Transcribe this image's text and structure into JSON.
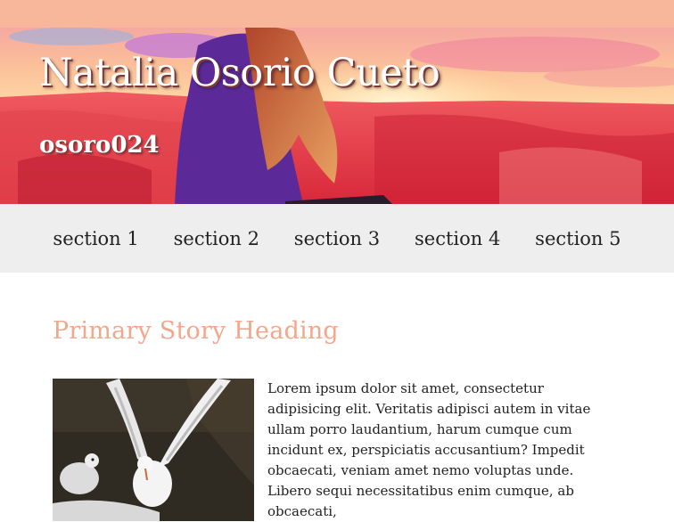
{
  "header": {
    "title": "Natalia Osorio Cueto",
    "subtitle": "osoro024",
    "background_icon": "desert-canyon-photo"
  },
  "nav": {
    "items": [
      {
        "label": "section 1"
      },
      {
        "label": "section 2"
      },
      {
        "label": "section 3"
      },
      {
        "label": "section 4"
      },
      {
        "label": "section 5"
      }
    ]
  },
  "main": {
    "heading": "Primary Story Heading",
    "image_icon": "seagulls-photo",
    "paragraphs": [
      "Lorem ipsum dolor sit amet, consectetur adipisicing elit. Veritatis adipisci autem in vitae ullam porro laudantium, harum cumque cum incidunt ex, perspiciatis accusantium? Impedit obcaecati, veniam amet nemo voluptas unde.",
      "Libero sequi necessitatibus enim cumque, ab obcaecati,"
    ]
  },
  "colors": {
    "topbar": "#f8b69a",
    "heading": "#f2a78a",
    "nav_bg": "#eeeeee",
    "text": "#222222"
  }
}
